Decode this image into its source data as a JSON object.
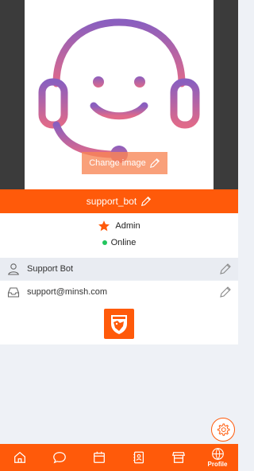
{
  "profile": {
    "change_image_label": "Change image",
    "username": "support_bot",
    "role": "Admin",
    "status": "Online",
    "display_name": "Support Bot",
    "email": "support@minsh.com"
  },
  "nav": {
    "active_label": "Profile",
    "items": [
      "home-icon",
      "chat-icon",
      "calendar-icon",
      "contacts-icon",
      "store-icon",
      "globe-icon"
    ]
  },
  "colors": {
    "accent": "#ff5a0a",
    "online": "#22c55e",
    "avatar_gradient_top": "#8a5fbf",
    "avatar_gradient_bottom": "#e06a8a"
  }
}
